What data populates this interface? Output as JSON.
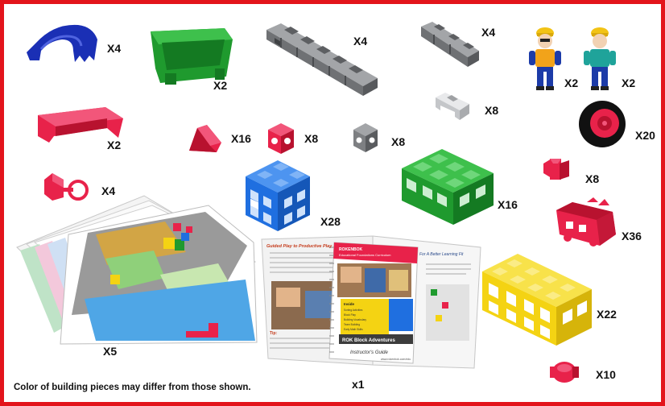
{
  "colors": {
    "frame": "#e3141b",
    "blue": "#1f6fe0",
    "dark_blue": "#1a2fb5",
    "green": "#1f9a2e",
    "gray": "#7d7f82",
    "light_gray": "#d5d6d8",
    "red": "#e8224a",
    "yellow": "#f4d313"
  },
  "pieces": [
    {
      "name": "blue-arch-piece",
      "qty": "X4"
    },
    {
      "name": "green-bin-piece",
      "qty": "X2"
    },
    {
      "name": "gray-long-beam-piece",
      "qty": "X4"
    },
    {
      "name": "gray-medium-beam-piece",
      "qty": "X4"
    },
    {
      "name": "figure-pair",
      "qty_a": "X2",
      "qty_b": "X2"
    },
    {
      "name": "red-bracket-piece",
      "qty": "X2"
    },
    {
      "name": "white-bridge-piece",
      "qty": "X8"
    },
    {
      "name": "red-wedge-piece",
      "qty": "X16"
    },
    {
      "name": "red-small-cube-piece",
      "qty": "X8"
    },
    {
      "name": "gray-small-cube-piece",
      "qty": "X8"
    },
    {
      "name": "wheel-piece",
      "qty": "X20"
    },
    {
      "name": "red-steering-piece",
      "qty": "X4"
    },
    {
      "name": "blue-2x2-cube-piece",
      "qty": "X28"
    },
    {
      "name": "green-2x3-block-piece",
      "qty": "X16"
    },
    {
      "name": "red-connector-piece",
      "qty": "X8"
    },
    {
      "name": "red-basket-piece",
      "qty": "X36"
    },
    {
      "name": "activity-cards",
      "qty": "X5"
    },
    {
      "name": "instructors-guide",
      "qty": "x1"
    },
    {
      "name": "yellow-2x4-block-piece",
      "qty": "X22"
    },
    {
      "name": "red-round-connector-piece",
      "qty": "X10"
    }
  ],
  "guide": {
    "left_heading": "Guided Play to Productive Play",
    "right_heading": "For A Better Learning Fit",
    "cover_brand": "ROKENBOK",
    "cover_subtitle": "Educational Foundations Curriculum",
    "cover_box_title": "Inside",
    "cover_box_items": [
      "Sorting Activities",
      "Block Play",
      "Building Vocabulary",
      "Team Building",
      "Early Math Skills"
    ],
    "cover_title": "ROK Block Adventures",
    "cover_label": "Instructor's Guide",
    "cover_url": "www.rokenbok.com/edu",
    "tip_label": "Tip:"
  },
  "caption": "Color of building pieces may differ from those shown."
}
